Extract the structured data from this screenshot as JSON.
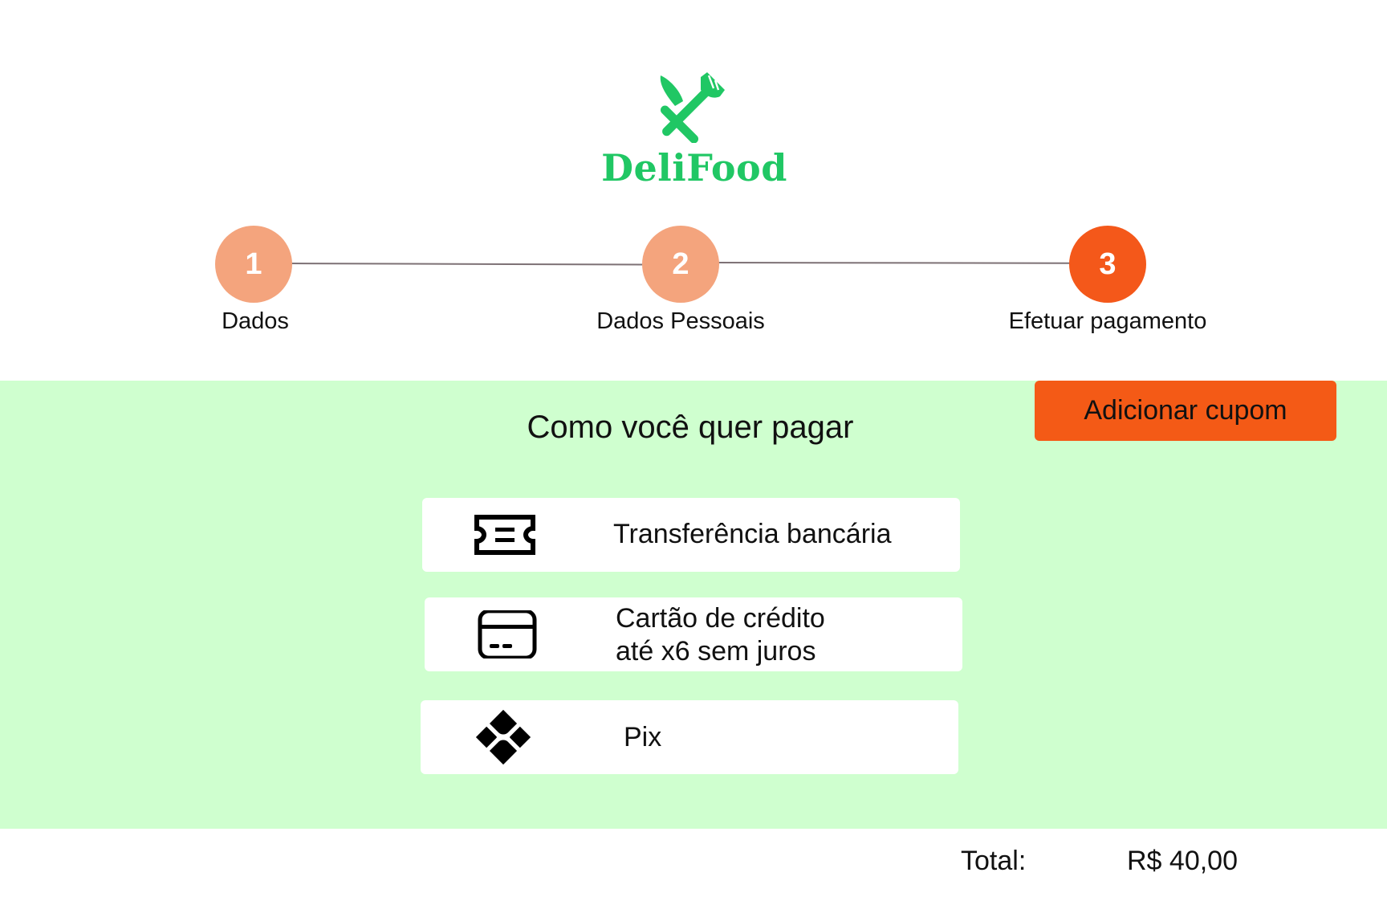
{
  "brand": {
    "name": "DeliFood",
    "color": "#20c764",
    "icon": "fork-knife-icon"
  },
  "stepper": {
    "steps": [
      {
        "number": "1",
        "label": "Dados",
        "state": "done",
        "color": "#f4a47d"
      },
      {
        "number": "2",
        "label": "Dados Pessoais",
        "state": "done",
        "color": "#f4a47d"
      },
      {
        "number": "3",
        "label": "Efetuar pagamento",
        "state": "current",
        "color": "#f4581a"
      }
    ]
  },
  "payment": {
    "title": "Como você quer pagar",
    "coupon_label": "Adicionar cupom",
    "options": [
      {
        "icon": "ticket-icon",
        "label": "Transferência bancária"
      },
      {
        "icon": "credit-card-icon",
        "label_line1": "Cartão de crédito",
        "label_line2": "até x6 sem juros"
      },
      {
        "icon": "pix-icon",
        "label": "Pix"
      }
    ],
    "panel_color": "#cfffcf",
    "accent_color": "#f45a16"
  },
  "total": {
    "label": "Total:",
    "value": "R$ 40,00"
  }
}
